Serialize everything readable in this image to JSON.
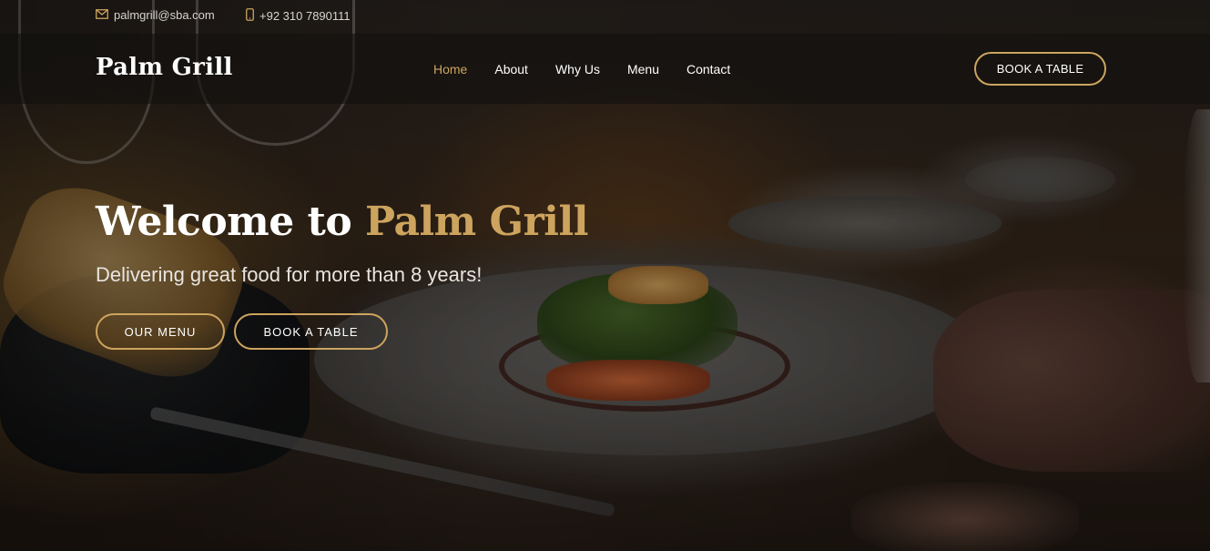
{
  "topbar": {
    "email": "palmgrill@sba.com",
    "phone": "+92 310 7890111",
    "email_icon": "envelope-icon",
    "phone_icon": "mobile-phone-icon"
  },
  "header": {
    "logo": "Palm Grill",
    "nav": [
      {
        "label": "Home",
        "active": true
      },
      {
        "label": "About",
        "active": false
      },
      {
        "label": "Why Us",
        "active": false
      },
      {
        "label": "Menu",
        "active": false
      },
      {
        "label": "Contact",
        "active": false
      }
    ],
    "book_button": "BOOK A TABLE"
  },
  "hero": {
    "title_prefix": "Welcome to",
    "title_accent": "Palm Grill",
    "subtitle": "Delivering great food for more than 8 years!",
    "menu_button": "OUR MENU",
    "book_button": "BOOK A TABLE"
  },
  "colors": {
    "accent": "#cda45e",
    "text": "#ffffff",
    "header_bg": "#12100e"
  }
}
